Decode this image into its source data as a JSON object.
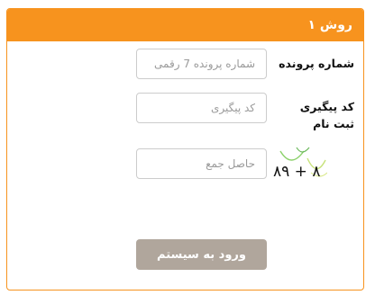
{
  "panel": {
    "title": "روش ۱",
    "accent_color": "#f7931e"
  },
  "form": {
    "file_number": {
      "label": "شماره پرونده",
      "placeholder": "شماره پرونده 7 رقمی",
      "value": ""
    },
    "tracking_code": {
      "label_line1": "کد پیگیری",
      "label_line2": "ثبت نام",
      "placeholder": "کد پیگیری",
      "value": ""
    },
    "captcha_sum": {
      "placeholder": "حاصل جمع",
      "value": "",
      "captcha_text": "۸۹ + ۸"
    },
    "submit": {
      "label": "ورود به سیستم",
      "color": "#b0a69c"
    }
  }
}
